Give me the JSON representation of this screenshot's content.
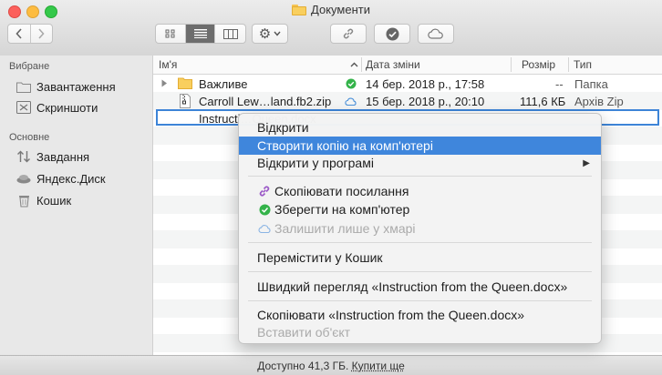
{
  "window": {
    "title": "Документи"
  },
  "sidebar": {
    "sections": [
      {
        "title": "Вибране",
        "items": [
          {
            "label": "Завантаження",
            "icon": "folder-icon"
          },
          {
            "label": "Скриншоти",
            "icon": "scissors-icon"
          }
        ]
      },
      {
        "title": "Основне",
        "items": [
          {
            "label": "Завдання",
            "icon": "sort-arrows-icon"
          },
          {
            "label": "Яндекс.Диск",
            "icon": "yandex-disk-icon"
          },
          {
            "label": "Кошик",
            "icon": "trash-icon"
          }
        ]
      }
    ]
  },
  "columns": {
    "name": "Ім'я",
    "date": "Дата зміни",
    "size": "Розмір",
    "kind": "Тип"
  },
  "files": [
    {
      "name": "Важливе",
      "status": "check-icon",
      "date": "14 бер. 2018 р., 17:58",
      "size": "--",
      "kind": "Папка"
    },
    {
      "name": "Carroll Lew…land.fb2.zip",
      "status": "cloud-icon",
      "date": "15 бер. 2018 р., 20:10",
      "size": "111,6 КБ",
      "kind": "Архів Zip"
    },
    {
      "name": "Instructi…Queen.docx",
      "status": "",
      "date": "",
      "size": "",
      "kind": ""
    }
  ],
  "context_menu": {
    "open": "Відкрити",
    "make_local_copy": "Створити копію на комп'ютері",
    "open_with": "Відкрити у програмі",
    "copy_link": "Скопіювати посилання",
    "save_to_computer": "Зберегти на комп'ютер",
    "keep_in_cloud_only": "Залишити лише у хмарі",
    "move_to_trash": "Перемістити у Кошик",
    "quick_look": "Швидкий перегляд «Instruction from the Queen.docx»",
    "copy_item": "Скопіювати «Instruction from the Queen.docx»",
    "paste_item": "Вставити об'єкт"
  },
  "status_bar": {
    "available": "Доступно 41,3 ГБ.",
    "buy": "Купити ще"
  },
  "colors": {
    "accent": "#3f86dc",
    "check": "#34b34a",
    "link": "#9b59c7",
    "cloud": "#4a90d9"
  }
}
